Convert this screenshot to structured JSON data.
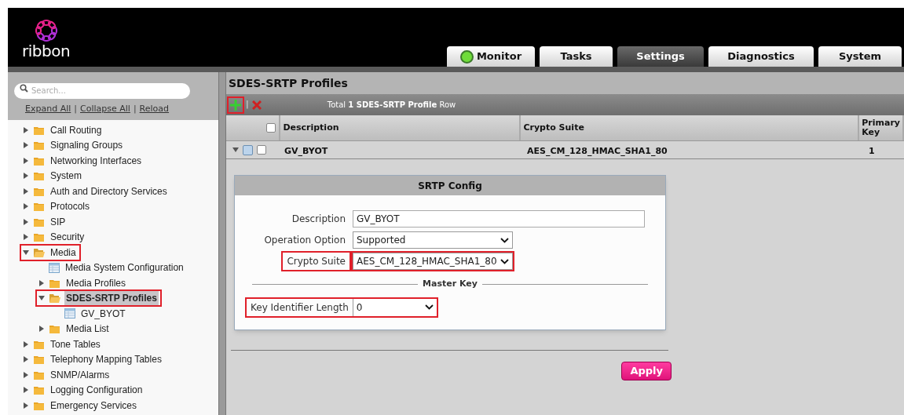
{
  "logo": {
    "text": "ribbon"
  },
  "tabs": [
    {
      "label": "Monitor",
      "selected": false,
      "status_light": true
    },
    {
      "label": "Tasks",
      "selected": false,
      "status_light": false
    },
    {
      "label": "Settings",
      "selected": true,
      "status_light": false
    },
    {
      "label": "Diagnostics",
      "selected": false,
      "status_light": false
    },
    {
      "label": "System",
      "selected": false,
      "status_light": false
    }
  ],
  "sidebar": {
    "search": {
      "placeholder": "Search..."
    },
    "links": [
      "Expand All",
      "Collapse All",
      "Reload"
    ],
    "link_separator": "|",
    "tree": [
      {
        "label": "Call Routing",
        "kind": "folder",
        "expanded": false,
        "selected": false,
        "highlighted": false
      },
      {
        "label": "Signaling Groups",
        "kind": "folder",
        "expanded": false,
        "selected": false,
        "highlighted": false
      },
      {
        "label": "Networking Interfaces",
        "kind": "folder",
        "expanded": false,
        "selected": false,
        "highlighted": false
      },
      {
        "label": "System",
        "kind": "folder",
        "expanded": false,
        "selected": false,
        "highlighted": false
      },
      {
        "label": "Auth and Directory Services",
        "kind": "folder",
        "expanded": false,
        "selected": false,
        "highlighted": false
      },
      {
        "label": "Protocols",
        "kind": "folder",
        "expanded": false,
        "selected": false,
        "highlighted": false
      },
      {
        "label": "SIP",
        "kind": "folder",
        "expanded": false,
        "selected": false,
        "highlighted": false
      },
      {
        "label": "Security",
        "kind": "folder",
        "expanded": false,
        "selected": false,
        "highlighted": false
      },
      {
        "label": "Media",
        "kind": "folder",
        "expanded": true,
        "selected": false,
        "highlighted": true,
        "children": [
          {
            "label": "Media System Configuration",
            "kind": "table",
            "selected": false,
            "highlighted": false
          },
          {
            "label": "Media Profiles",
            "kind": "folder",
            "expanded": false,
            "selected": false,
            "highlighted": false
          },
          {
            "label": "SDES-SRTP Profiles",
            "kind": "folder",
            "expanded": true,
            "selected": true,
            "highlighted": true,
            "children": [
              {
                "label": "GV_BYOT",
                "kind": "table",
                "selected": false,
                "highlighted": false
              }
            ]
          },
          {
            "label": "Media List",
            "kind": "folder",
            "expanded": false,
            "selected": false,
            "highlighted": false
          }
        ]
      },
      {
        "label": "Tone Tables",
        "kind": "folder",
        "expanded": false,
        "selected": false,
        "highlighted": false
      },
      {
        "label": "Telephony Mapping Tables",
        "kind": "folder",
        "expanded": false,
        "selected": false,
        "highlighted": false
      },
      {
        "label": "SNMP/Alarms",
        "kind": "folder",
        "expanded": false,
        "selected": false,
        "highlighted": false
      },
      {
        "label": "Logging Configuration",
        "kind": "folder",
        "expanded": false,
        "selected": false,
        "highlighted": false
      },
      {
        "label": "Emergency Services",
        "kind": "folder",
        "expanded": false,
        "selected": false,
        "highlighted": false
      }
    ]
  },
  "page": {
    "title": "SDES-SRTP Profiles",
    "toolbar": {
      "add_highlighted": true,
      "separator": "|",
      "total_prefix": "Total",
      "total_bold": "1 SDES-SRTP Profile",
      "total_suffix": "Row"
    },
    "table": {
      "select_all_checked": false,
      "columns": [
        "Description",
        "Crypto Suite",
        "Primary Key"
      ],
      "rows": [
        {
          "cells": [
            "GV_BYOT",
            "AES_CM_128_HMAC_SHA1_80",
            "1"
          ],
          "expanded": true,
          "checked": false
        }
      ]
    },
    "config": {
      "title": "SRTP Config",
      "fields": [
        {
          "label": "Description",
          "kind": "text",
          "value": "GV_BYOT",
          "highlighted": false
        },
        {
          "label": "Operation Option",
          "kind": "select",
          "value": "Supported",
          "highlighted": false
        },
        {
          "label": "Crypto Suite",
          "kind": "select",
          "value": "AES_CM_128_HMAC_SHA1_80",
          "highlighted": true
        }
      ],
      "section": "Master Key",
      "section_fields": [
        {
          "label": "Key Identifier Length",
          "kind": "select",
          "value": "0",
          "highlighted": true
        }
      ]
    },
    "apply_button": "Apply"
  }
}
